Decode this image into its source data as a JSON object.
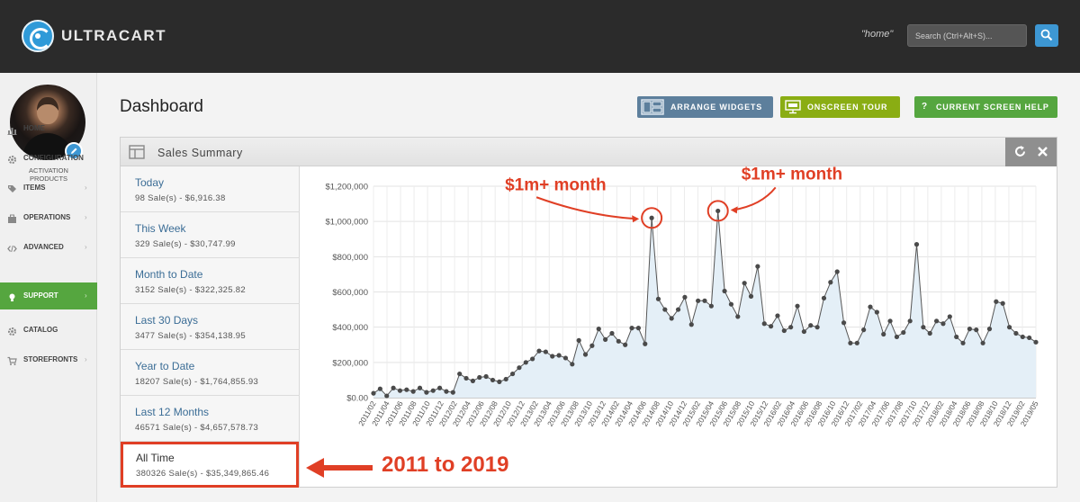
{
  "app": {
    "brand": "ULTRACART",
    "home_link": "\"home\""
  },
  "search": {
    "placeholder": "Search (Ctrl+Alt+S)...",
    "value": ""
  },
  "sidebar": {
    "org_name_line1": "ACTIVATION",
    "org_name_line2": "PRODUCTS",
    "items": [
      {
        "label": "HOME",
        "icon": "chart-icon",
        "has_chevron": false
      },
      {
        "label": "CONFIGURATION",
        "icon": "gear-icon",
        "has_chevron": false
      },
      {
        "label": "ITEMS",
        "icon": "tag-icon",
        "has_chevron": true
      },
      {
        "label": "OPERATIONS",
        "icon": "briefcase-icon",
        "has_chevron": true
      },
      {
        "label": "ADVANCED",
        "icon": "code-icon",
        "has_chevron": true
      },
      {
        "label": "SUPPORT",
        "icon": "lightbulb-icon",
        "has_chevron": true,
        "active": true
      },
      {
        "label": "CATALOG",
        "icon": "gear-icon",
        "has_chevron": false
      },
      {
        "label": "STOREFRONTS",
        "icon": "cart-icon",
        "has_chevron": true
      }
    ],
    "active_color": "#55a63f"
  },
  "page": {
    "title": "Dashboard"
  },
  "toolbar": {
    "arrange_label": "ARRANGE WIDGETS",
    "tour_label": "ONSCREEN TOUR",
    "help_label": "CURRENT SCREEN HELP"
  },
  "widget": {
    "title": "Sales Summary",
    "periods": [
      {
        "period": "Today",
        "value": "98 Sale(s) - $6,916.38"
      },
      {
        "period": "This Week",
        "value": "329 Sale(s) - $30,747.99"
      },
      {
        "period": "Month to Date",
        "value": "3152 Sale(s) - $322,325.82"
      },
      {
        "period": "Last 30 Days",
        "value": "3477 Sale(s) - $354,138.95"
      },
      {
        "period": "Year to Date",
        "value": "18207 Sale(s) - $1,764,855.93"
      },
      {
        "period": "Last 12 Months",
        "value": "46571 Sale(s) - $4,657,578.73"
      },
      {
        "period": "All Time",
        "value": "380326 Sale(s) - $35,349,865.46",
        "highlighted": true
      }
    ]
  },
  "annotations": {
    "peak_label": "$1m+ month",
    "range_label": "2011 to 2019",
    "color": "#e03f25"
  },
  "chart_data": {
    "type": "area",
    "ylim": [
      0,
      1200000
    ],
    "yticks": [
      "$0.00",
      "$200,000",
      "$400,000",
      "$600,000",
      "$800,000",
      "$1,000,000",
      "$1,200,000"
    ],
    "xtick_labels": [
      "2011/02",
      "2011/04",
      "2011/06",
      "2011/08",
      "2011/10",
      "2011/12",
      "2012/02",
      "2012/04",
      "2012/06",
      "2012/08",
      "2012/10",
      "2012/12",
      "2013/02",
      "2013/04",
      "2013/06",
      "2013/08",
      "2013/10",
      "2013/12",
      "2014/02",
      "2014/04",
      "2014/06",
      "2014/08",
      "2014/10",
      "2014/12",
      "2015/02",
      "2015/04",
      "2015/06",
      "2015/08",
      "2015/10",
      "2015/12",
      "2016/02",
      "2016/04",
      "2016/06",
      "2016/08",
      "2016/10",
      "2016/12",
      "2017/02",
      "2017/04",
      "2017/06",
      "2017/08",
      "2017/10",
      "2017/12",
      "2018/02",
      "2018/04",
      "2018/06",
      "2018/08",
      "2018/10",
      "2018/12",
      "2019/02",
      "2019/05"
    ],
    "series": [
      {
        "start": "2011/02",
        "values": [
          25000,
          50000,
          10000,
          55000,
          40000,
          45000,
          35000,
          55000,
          30000,
          40000,
          55000,
          35000,
          30000,
          135000,
          110000,
          95000,
          115000,
          120000,
          100000,
          90000,
          105000,
          135000,
          170000,
          200000,
          220000,
          265000,
          260000,
          235000,
          240000,
          225000,
          190000,
          325000,
          245000,
          295000,
          390000,
          330000,
          365000,
          320000,
          300000,
          395000,
          395000,
          305000,
          1020000,
          560000,
          500000,
          450000,
          500000,
          570000,
          415000,
          550000,
          550000,
          520000,
          1060000,
          605000,
          530000,
          460000,
          650000,
          575000,
          745000,
          420000,
          405000,
          465000,
          380000,
          400000,
          520000,
          375000,
          410000,
          400000,
          565000,
          655000,
          715000,
          425000,
          310000,
          310000,
          385000,
          515000,
          485000,
          360000,
          435000,
          345000,
          370000,
          435000,
          870000,
          400000,
          365000,
          435000,
          420000,
          460000,
          345000,
          310000,
          390000,
          385000,
          310000,
          390000,
          545000,
          535000,
          400000,
          365000,
          345000,
          340000,
          315000
        ]
      }
    ],
    "line_color": "#555555",
    "fill_color": "#e4eff7",
    "grid": true
  }
}
